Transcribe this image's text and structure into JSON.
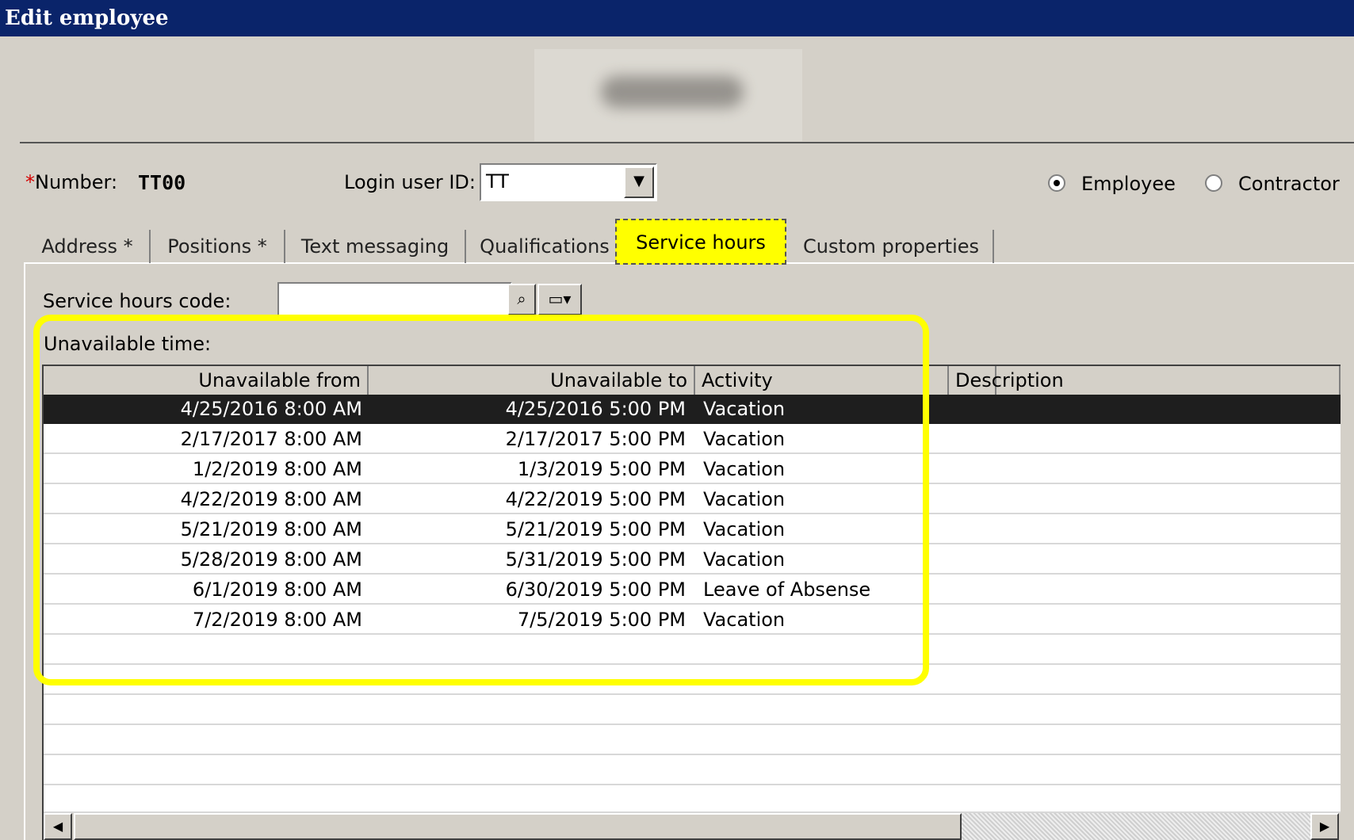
{
  "window": {
    "title": "Edit employee"
  },
  "employee": {
    "required_marker": "*",
    "number_label": "Number:",
    "number_value": "TT00",
    "login_label": "Login user ID:",
    "login_value": "TT"
  },
  "type_options": [
    {
      "label": "Employee",
      "selected": true
    },
    {
      "label": "Contractor",
      "selected": false
    }
  ],
  "tabs": [
    {
      "label": "Address *"
    },
    {
      "label": "Positions *"
    },
    {
      "label": "Text messaging"
    },
    {
      "label": "Qualifications"
    },
    {
      "label": "Service hours"
    },
    {
      "label": "Custom properties"
    }
  ],
  "active_tab": "Service hours",
  "service_hours": {
    "code_label": "Service hours code:",
    "code_value": "",
    "unavailable_label": "Unavailable time:"
  },
  "grid": {
    "columns": [
      "Unavailable from",
      "Unavailable to",
      "Activity",
      "Description"
    ],
    "rows": [
      {
        "from": "4/25/2016 8:00 AM",
        "to": "4/25/2016 5:00 PM",
        "activity": "Vacation",
        "description": "",
        "selected": true
      },
      {
        "from": "2/17/2017 8:00 AM",
        "to": "2/17/2017 5:00 PM",
        "activity": "Vacation",
        "description": ""
      },
      {
        "from": "1/2/2019 8:00 AM",
        "to": "1/3/2019 5:00 PM",
        "activity": "Vacation",
        "description": ""
      },
      {
        "from": "4/22/2019 8:00 AM",
        "to": "4/22/2019 5:00 PM",
        "activity": "Vacation",
        "description": ""
      },
      {
        "from": "5/21/2019 8:00 AM",
        "to": "5/21/2019 5:00 PM",
        "activity": "Vacation",
        "description": ""
      },
      {
        "from": "5/28/2019 8:00 AM",
        "to": "5/31/2019 5:00 PM",
        "activity": "Vacation",
        "description": ""
      },
      {
        "from": "6/1/2019 8:00 AM",
        "to": "6/30/2019 5:00 PM",
        "activity": "Leave of Absense",
        "description": ""
      },
      {
        "from": "7/2/2019 8:00 AM",
        "to": "7/5/2019 5:00 PM",
        "activity": "Vacation",
        "description": ""
      }
    ]
  },
  "colors": {
    "titlebar": "#0a246a",
    "highlight": "#ffff00",
    "selected_row": "#1e1e1e",
    "dialog": "#d4d0c8"
  },
  "icons": {
    "dropdown": "chevron-down-icon",
    "search": "magnifier-icon",
    "lookup": "lookup-menu-icon",
    "scroll_left": "arrow-left-icon",
    "scroll_right": "arrow-right-icon"
  }
}
